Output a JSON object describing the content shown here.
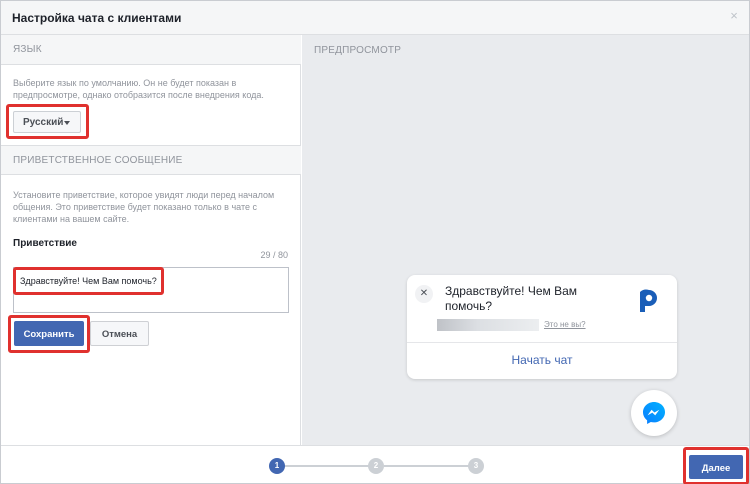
{
  "dialog": {
    "title": "Настройка чата с клиентами",
    "close_glyph": "×"
  },
  "language": {
    "section_title": "ЯЗЫК",
    "description": "Выберите язык по умолчанию. Он не будет показан в предпросмотре, однако отобразится после внедрения кода.",
    "selected": "Русский"
  },
  "greeting": {
    "section_title": "ПРИВЕТСТВЕННОЕ СООБЩЕНИЕ",
    "description": "Установите приветствие, которое увидят люди перед началом общения. Это приветствие будет показано только в чате с клиентами на вашем сайте.",
    "field_label": "Приветствие",
    "counter": "29 / 80",
    "value": "Здравствуйте! Чем Вам помочь?",
    "save_label": "Сохранить",
    "cancel_label": "Отмена"
  },
  "preview": {
    "section_title": "ПРЕДПРОСМОТР",
    "close_glyph": "✕",
    "message": "Здравствуйте! Чем Вам помочь?",
    "not_you": "Это не вы?",
    "start_chat": "Начать чат",
    "icons": [
      "close-icon",
      "page-logo-icon",
      "messenger-icon"
    ]
  },
  "footer": {
    "steps": [
      {
        "label": "1",
        "state": "active"
      },
      {
        "label": "2",
        "state": "inactive"
      },
      {
        "label": "3",
        "state": "inactive"
      }
    ],
    "next_label": "Далее"
  },
  "colors": {
    "accent": "#4267b2",
    "highlight": "#e0312e",
    "preview_bg": "#e9ebee"
  }
}
